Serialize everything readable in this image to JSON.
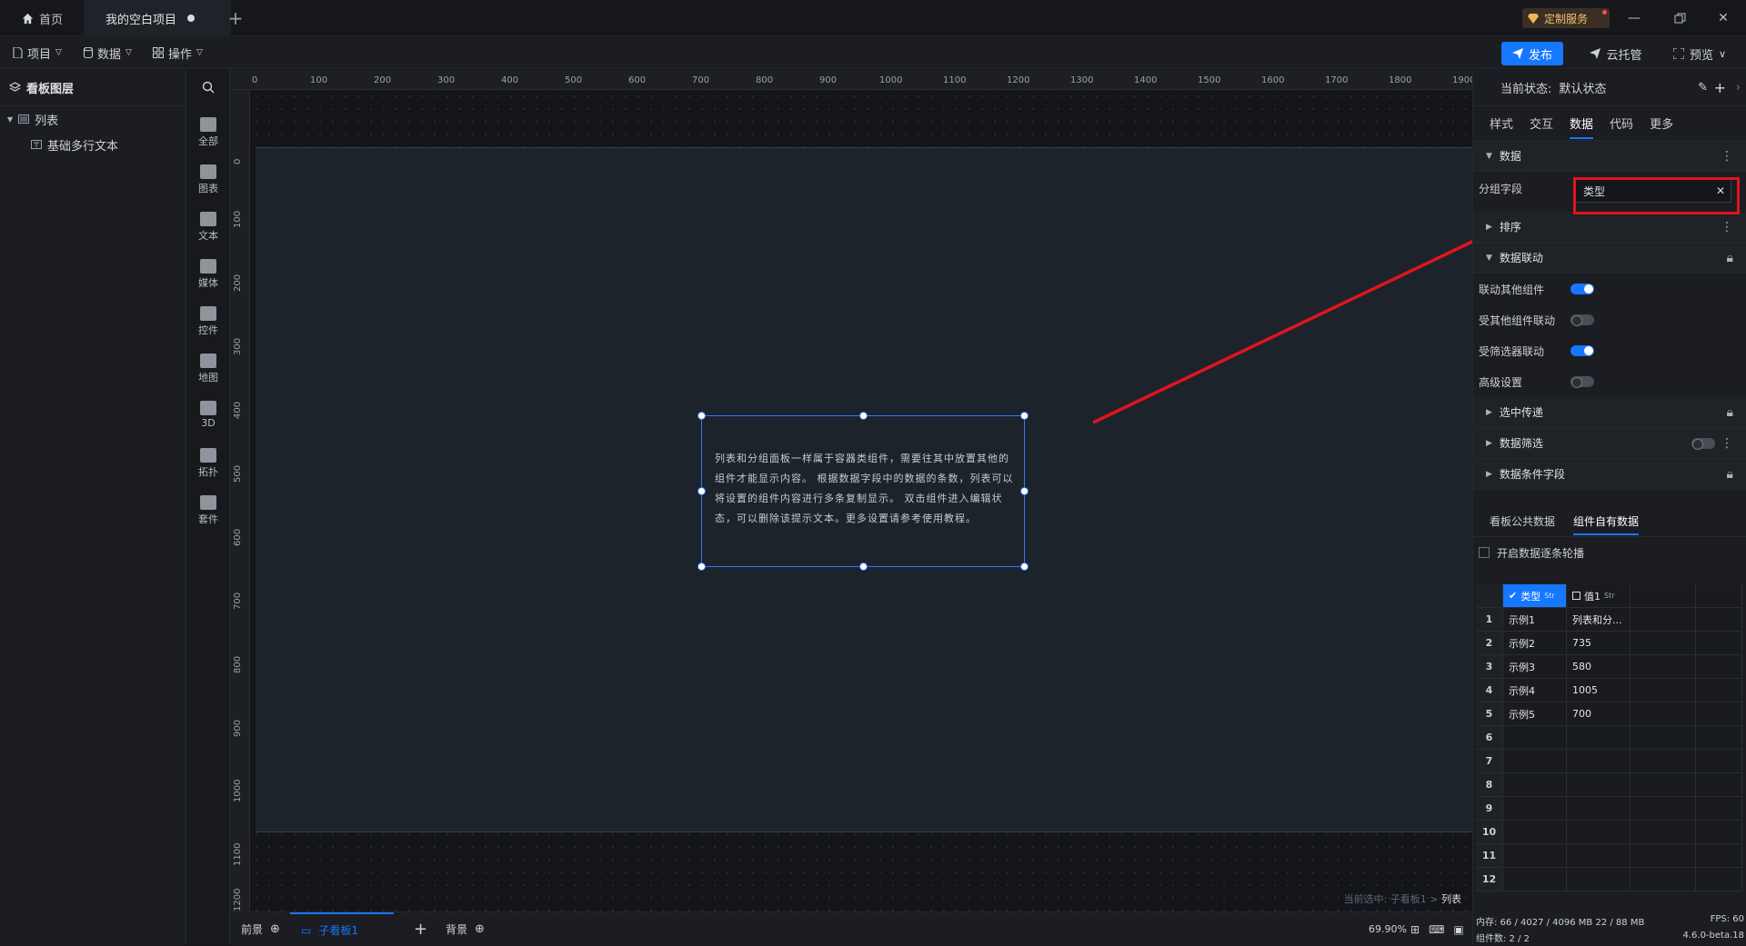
{
  "titlebar": {
    "home_tab": "首页",
    "project_tab": "我的空白项目",
    "service_label": "定制服务"
  },
  "toolbar": {
    "menus": [
      "项目",
      "数据",
      "操作"
    ],
    "publish_label": "发布",
    "cloud_label": "云托管",
    "preview_label": "预览"
  },
  "layers": {
    "title": "看板图层",
    "items": [
      {
        "label": "列表"
      },
      {
        "label": "基础多行文本"
      }
    ]
  },
  "components": [
    {
      "label": "全部",
      "icon": "grid-icon"
    },
    {
      "label": "图表",
      "icon": "bar-chart-icon"
    },
    {
      "label": "文本",
      "icon": "text-icon"
    },
    {
      "label": "媒体",
      "icon": "media-icon"
    },
    {
      "label": "控件",
      "icon": "control-icon"
    },
    {
      "label": "地图",
      "icon": "map-icon"
    },
    {
      "label": "3D",
      "icon": "cube-icon"
    },
    {
      "label": "拓扑",
      "icon": "topology-icon"
    },
    {
      "label": "套件",
      "icon": "suite-icon"
    }
  ],
  "ruler": {
    "top": [
      "0",
      "100",
      "200",
      "300",
      "400",
      "500",
      "600",
      "700",
      "800",
      "900",
      "1000",
      "1100",
      "1200",
      "1300",
      "1400",
      "1500",
      "1600",
      "1700",
      "1800",
      "1900"
    ],
    "left": [
      "0",
      "100",
      "200",
      "300",
      "400",
      "500",
      "600",
      "700",
      "800",
      "900",
      "1000",
      "1100",
      "1200"
    ]
  },
  "canvas": {
    "component_text": "列表和分组面板一样属于容器类组件，需要往其中放置其他的组件才能显示内容。 根据数据字段中的数据的条数，列表可以将设置的组件内容进行多条复制显示。 双击组件进入编辑状态，可以删除该提示文本。更多设置请参考使用教程。",
    "selection_prefix": "当前选中: 子看板1 > ",
    "selection_target": "列表"
  },
  "bottombar": {
    "foreground": "前景",
    "subboard": "子看板1",
    "background": "背景",
    "zoom": "69.90%"
  },
  "inspector": {
    "state_label": "当前状态:",
    "state_value": "默认状态",
    "tabs": [
      "样式",
      "交互",
      "数据",
      "代码",
      "更多"
    ],
    "active_tab": "数据",
    "sections": {
      "data": "数据",
      "group_field_label": "分组字段",
      "group_field_value": "类型",
      "sort": "排序",
      "linkage": "数据联动",
      "link_others": "联动其他组件",
      "linked_by_others": "受其他组件联动",
      "linked_by_filter": "受筛选器联动",
      "advanced": "高级设置",
      "select_pass": "选中传递",
      "data_filter": "数据筛选",
      "condition_field": "数据条件字段"
    },
    "toggles": {
      "link_others": true,
      "linked_by_others": false,
      "linked_by_filter": true,
      "advanced": false
    },
    "data_tabs": [
      "看板公共数据",
      "组件自有数据"
    ],
    "carousel_label": "开启数据逐条轮播",
    "grid": {
      "columns": [
        {
          "name": "类型",
          "type": "Str",
          "checked": true
        },
        {
          "name": "值1",
          "type": "Str",
          "checked": false
        }
      ],
      "row_numbers": [
        "1",
        "2",
        "3",
        "4",
        "5",
        "6",
        "7",
        "8",
        "9",
        "10",
        "11",
        "12"
      ],
      "rows": [
        [
          "示例1",
          "列表和分..."
        ],
        [
          "示例2",
          "735"
        ],
        [
          "示例3",
          "580"
        ],
        [
          "示例4",
          "1005"
        ],
        [
          "示例5",
          "700"
        ]
      ]
    }
  },
  "sysinfo": {
    "memory": "内存: 66 / 4027 / 4096 MB 22 / 88 MB",
    "fps": "FPS: 60",
    "component_count": "组件数: 2 / 2",
    "version": "4.6.0-beta.18"
  }
}
